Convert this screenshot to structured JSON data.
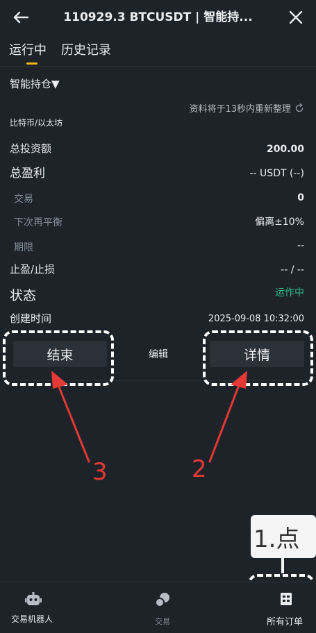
{
  "header": {
    "title": "110929.3 BTCUSDT | 智能持..."
  },
  "tabs": [
    {
      "label": "运行中"
    },
    {
      "label": "历史记录"
    }
  ],
  "section": {
    "title": "智能持仓▼",
    "refresh_text": "资料将于13秒内重新整理",
    "pair_label": "比特币/以太坊"
  },
  "details": {
    "total_invest_label": "总投资额",
    "total_invest_value": "200.00",
    "total_pnl_label": "总盈利",
    "total_pnl_value": "-- USDT (--)",
    "trades_label": "交易",
    "trades_value": "0",
    "next_rebalance_label": "下次再平衡",
    "next_rebalance_value": "偏离±10%",
    "period_label": "期限",
    "period_value": "--",
    "tpsl_label": "止盈/止损",
    "tpsl_value": "-- / --",
    "status_label": "状态",
    "status_value": "运作中",
    "created_label": "创建时间",
    "created_value": "2025-09-08 10:32:00"
  },
  "actions": {
    "end_label": "结束",
    "edit_label": "编辑",
    "details_label": "详情"
  },
  "annotations": {
    "num3": "3",
    "num2": "2",
    "tooltip": "1.点"
  },
  "bottom_nav": [
    {
      "label": "交易机器人"
    },
    {
      "label": "交易"
    },
    {
      "label": "所有订单"
    }
  ],
  "colors": {
    "background": "#1e2329",
    "accent": "#f0b90b",
    "status_green": "#2ebd85",
    "annotation_red": "#e53935"
  }
}
